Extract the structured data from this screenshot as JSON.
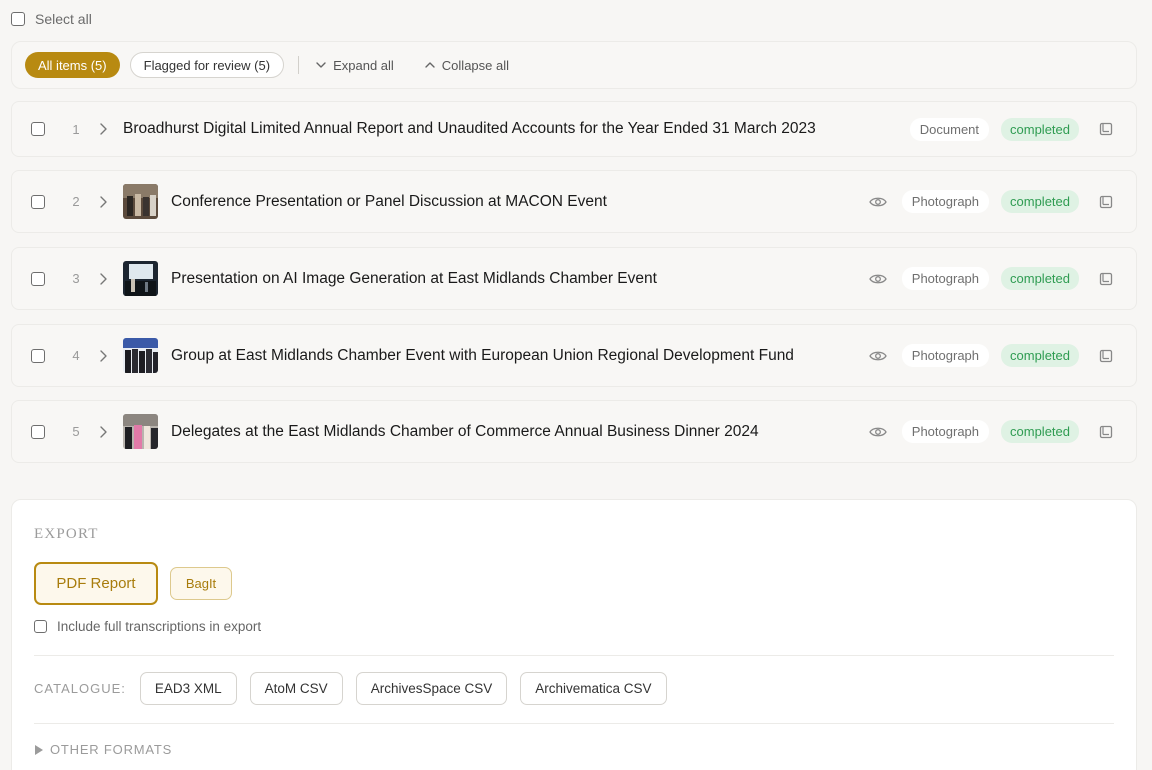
{
  "select_all": {
    "label": "Select all"
  },
  "filters": {
    "all_items": "All items (5)",
    "flagged": "Flagged for review (5)",
    "expand_all": "Expand all",
    "collapse_all": "Collapse all"
  },
  "items": [
    {
      "number": "1",
      "title": "Broadhurst Digital Limited Annual Report and Unaudited Accounts for the Year Ended 31 March 2023",
      "type": "Document",
      "status": "completed",
      "has_thumbnail": false
    },
    {
      "number": "2",
      "title": "Conference Presentation or Panel Discussion at MACON Event",
      "type": "Photograph",
      "status": "completed",
      "has_thumbnail": true
    },
    {
      "number": "3",
      "title": "Presentation on AI Image Generation at East Midlands Chamber Event",
      "type": "Photograph",
      "status": "completed",
      "has_thumbnail": true
    },
    {
      "number": "4",
      "title": "Group at East Midlands Chamber Event with European Union Regional Development Fund",
      "type": "Photograph",
      "status": "completed",
      "has_thumbnail": true
    },
    {
      "number": "5",
      "title": "Delegates at the East Midlands Chamber of Commerce Annual Business Dinner 2024",
      "type": "Photograph",
      "status": "completed",
      "has_thumbnail": true
    }
  ],
  "export": {
    "title": "EXPORT",
    "pdf_report": "PDF Report",
    "bagit": "BagIt",
    "include_transcriptions": "Include full transcriptions in export",
    "catalogue_label": "CATALOGUE:",
    "catalogue_formats": [
      "EAD3 XML",
      "AtoM CSV",
      "ArchivesSpace CSV",
      "Archivematica CSV"
    ],
    "other_formats": "OTHER FORMATS"
  },
  "colors": {
    "accent": "#b88a11",
    "status_text": "#2f9c52",
    "status_bg": "#dff2e4"
  },
  "icons": {
    "expand": "chevron-down-icon",
    "collapse": "chevron-up-icon",
    "row_expand": "chevron-right-icon",
    "preview": "eye-icon",
    "open": "book-icon",
    "disclosure": "triangle-right-icon"
  }
}
